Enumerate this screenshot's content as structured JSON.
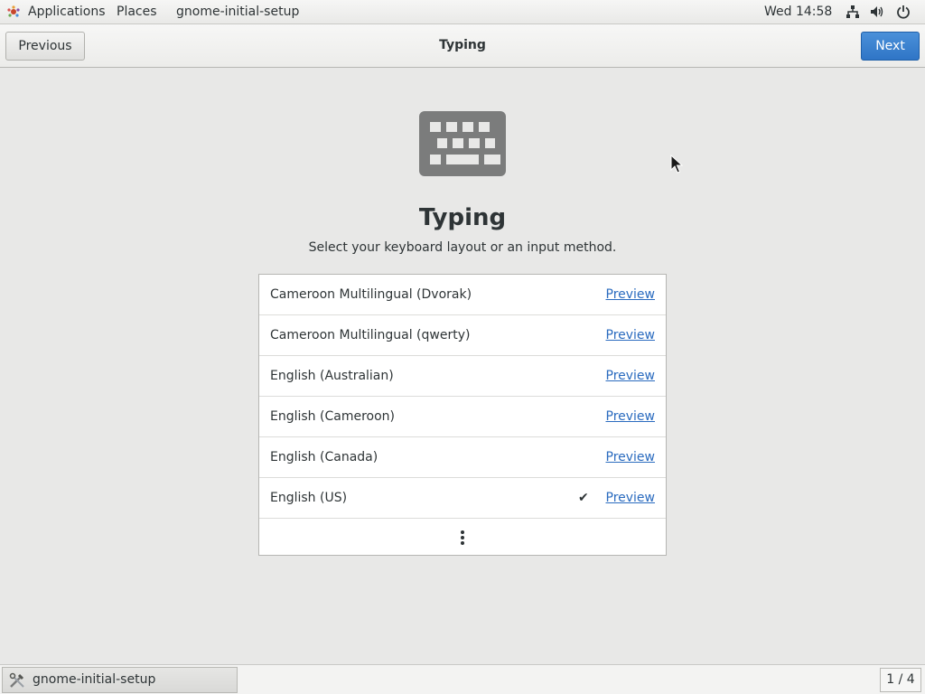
{
  "top_panel": {
    "applications_label": "Applications",
    "places_label": "Places",
    "app_label": "gnome-initial-setup",
    "clock": "Wed 14:58",
    "tray_icons": [
      "network-icon",
      "volume-icon",
      "power-icon"
    ]
  },
  "header": {
    "previous_label": "Previous",
    "title": "Typing",
    "next_label": "Next"
  },
  "page": {
    "icon": "keyboard-icon",
    "heading": "Typing",
    "subtitle": "Select your keyboard layout or an input method."
  },
  "layouts": [
    {
      "name": "Cameroon Multilingual (Dvorak)",
      "preview": "Preview",
      "selected": false
    },
    {
      "name": "Cameroon Multilingual (qwerty)",
      "preview": "Preview",
      "selected": false
    },
    {
      "name": "English (Australian)",
      "preview": "Preview",
      "selected": false
    },
    {
      "name": "English (Cameroon)",
      "preview": "Preview",
      "selected": false
    },
    {
      "name": "English (Canada)",
      "preview": "Preview",
      "selected": false
    },
    {
      "name": "English (US)",
      "preview": "Preview",
      "selected": true
    }
  ],
  "more_icon": "more-vertical-icon",
  "taskbar": {
    "task_label": "gnome-initial-setup",
    "workspace": "1 / 4"
  },
  "colors": {
    "accent": "#3584e4",
    "link": "#2a6bbf",
    "background": "#e8e8e7"
  }
}
